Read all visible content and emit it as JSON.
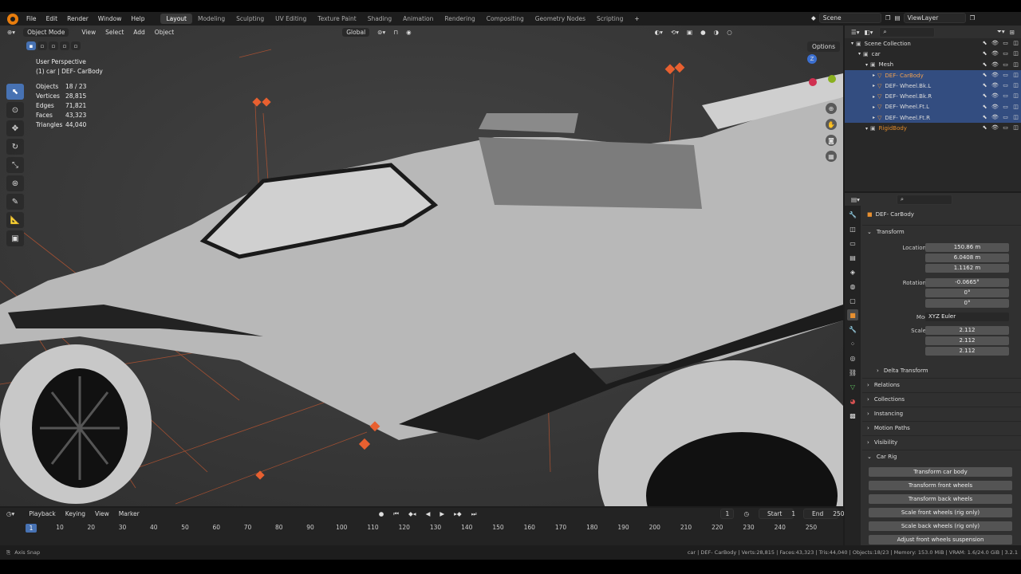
{
  "menu": [
    "File",
    "Edit",
    "Render",
    "Window",
    "Help"
  ],
  "workspaces": [
    "Layout",
    "Modeling",
    "Sculpting",
    "UV Editing",
    "Texture Paint",
    "Shading",
    "Animation",
    "Rendering",
    "Compositing",
    "Geometry Nodes",
    "Scripting",
    "+"
  ],
  "active_workspace": "Layout",
  "scene": "Scene",
  "view_layer": "ViewLayer",
  "viewport": {
    "mode": "Object Mode",
    "menus": [
      "View",
      "Select",
      "Add",
      "Object"
    ],
    "orientation": "Global",
    "options": "Options",
    "perspective": "User Perspective",
    "context": "(1) car | DEF- CarBody",
    "stats": [
      {
        "label": "Objects",
        "value": "18 / 23"
      },
      {
        "label": "Vertices",
        "value": "28,815"
      },
      {
        "label": "Edges",
        "value": "71,821"
      },
      {
        "label": "Faces",
        "value": "43,323"
      },
      {
        "label": "Triangles",
        "value": "44,040"
      }
    ]
  },
  "outliner": {
    "rows": [
      {
        "name": "Scene Collection",
        "sel": false,
        "indent": 0,
        "color": "#ddd"
      },
      {
        "name": "car",
        "sel": false,
        "indent": 1,
        "color": "#ddd"
      },
      {
        "name": "Mesh",
        "sel": false,
        "indent": 2,
        "color": "#ddd"
      },
      {
        "name": "DEF- CarBody",
        "sel": true,
        "indent": 3,
        "color": "#f0a050"
      },
      {
        "name": "DEF- Wheel.Bk.L",
        "sel": true,
        "indent": 3,
        "color": "#ddd"
      },
      {
        "name": "DEF- Wheel.Bk.R",
        "sel": true,
        "indent": 3,
        "color": "#ddd"
      },
      {
        "name": "DEF- Wheel.Ft.L",
        "sel": true,
        "indent": 3,
        "color": "#ddd"
      },
      {
        "name": "DEF- Wheel.Ft.R",
        "sel": true,
        "indent": 3,
        "color": "#ddd"
      },
      {
        "name": "RigidBody",
        "sel": false,
        "indent": 2,
        "color": "#e08a2a"
      }
    ]
  },
  "properties": {
    "object": "DEF- CarBody",
    "transform": "Transform",
    "location": {
      "label": "Location X",
      "x": "150.86 m",
      "y": "6.0408 m",
      "z": "1.1162 m"
    },
    "rotation": {
      "label": "Rotation X",
      "x": "-0.0665°",
      "y": "0°",
      "z": "0°"
    },
    "mode_label": "Mode",
    "mode": "XYZ Euler",
    "scale": {
      "label": "Scale X",
      "x": "2.112",
      "y": "2.112",
      "z": "2.112"
    },
    "axis_y": "Y",
    "axis_z": "Z",
    "sections": [
      "Delta Transform",
      "Relations",
      "Collections",
      "Instancing",
      "Motion Paths",
      "Visibility",
      "Car Rig"
    ],
    "rig_buttons": [
      "Transform car body",
      "Transform front wheels",
      "Transform back wheels",
      "Scale front wheels (rig only)",
      "Scale back wheels (rig only)",
      "Adjust front wheels suspension"
    ]
  },
  "timeline": {
    "menus": [
      "Playback",
      "Keying",
      "View",
      "Marker"
    ],
    "current": "1",
    "start_label": "Start",
    "start": "1",
    "end_label": "End",
    "end": "250",
    "ticks": [
      "10",
      "20",
      "30",
      "40",
      "50",
      "60",
      "70",
      "80",
      "90",
      "100",
      "110",
      "120",
      "130",
      "140",
      "150",
      "160",
      "170",
      "180",
      "190",
      "200",
      "210",
      "220",
      "230",
      "240",
      "250"
    ],
    "frame": "1"
  },
  "status": {
    "left": "Axis Snap",
    "right": "car | DEF- CarBody | Verts:28,815 | Faces:43,323 | Tris:44,040 | Objects:18/23 | Memory: 153.0 MiB | VRAM: 1.6/24.0 GiB | 3.2.1"
  }
}
